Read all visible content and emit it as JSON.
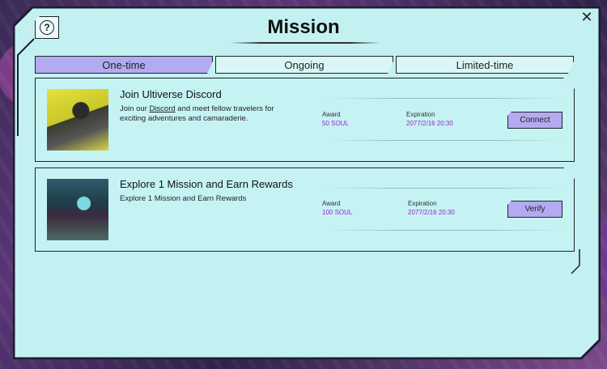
{
  "dialog": {
    "title": "Mission",
    "help_symbol": "?",
    "close_symbol": "✕"
  },
  "tabs": [
    {
      "label": "One-time",
      "active": true
    },
    {
      "label": "Ongoing",
      "active": false
    },
    {
      "label": "Limited-time",
      "active": false
    }
  ],
  "missions": [
    {
      "title": "Join Ultiverse Discord",
      "desc_prefix": "Join our ",
      "desc_link": "Discord",
      "desc_suffix": " and meet fellow travelers for exciting adventures and camaraderie.",
      "award_label": "Award",
      "award_value": "50 SOUL",
      "expiration_label": "Expiration",
      "expiration_value": "2077/2/16 20:30",
      "action_label": "Connect"
    },
    {
      "title": "Explore 1 Mission and Earn Rewards",
      "desc_prefix": "Explore 1 Mission and Earn Rewards",
      "desc_link": "",
      "desc_suffix": "",
      "award_label": "Award",
      "award_value": "100 SOUL",
      "expiration_label": "Expiration",
      "expiration_value": "2077/2/16 20:30",
      "action_label": "Verify"
    }
  ],
  "colors": {
    "panel_bg": "#c3f1f2",
    "accent": "#b3aaf2",
    "award_text": "#9b27c8"
  }
}
